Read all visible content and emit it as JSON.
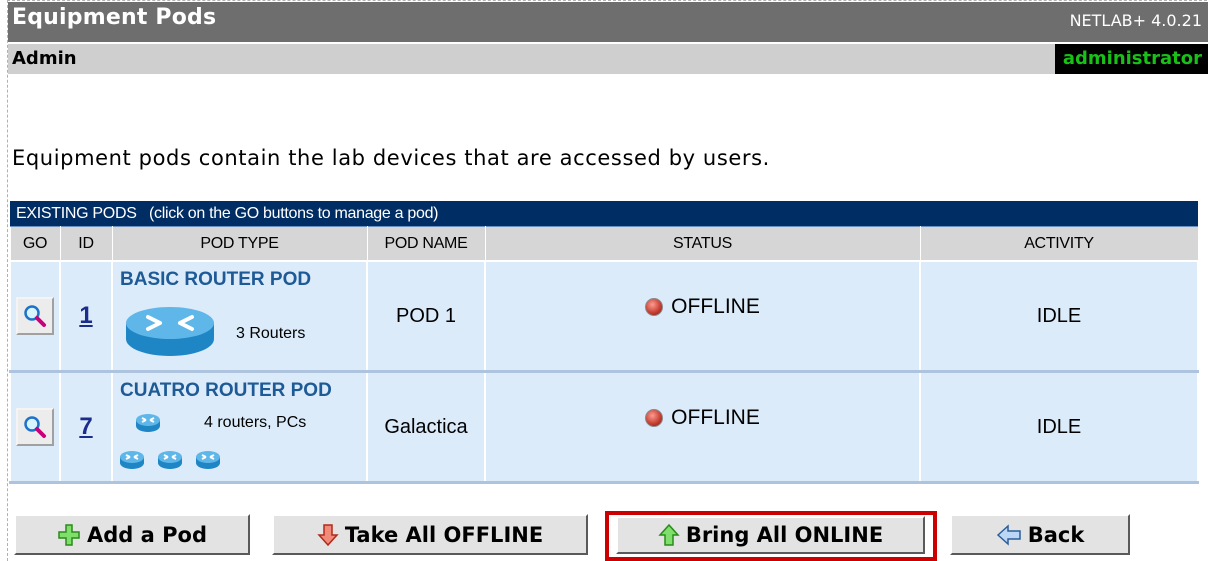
{
  "header": {
    "title": "Equipment Pods",
    "version": "NETLAB+ 4.0.21",
    "section": "Admin",
    "user": "administrator"
  },
  "intro": "Equipment pods contain the lab devices that are accessed by users.",
  "table": {
    "caption": "EXISTING PODS   (click on the GO buttons to manage a pod)",
    "columns": [
      "GO",
      "ID",
      "POD TYPE",
      "POD NAME",
      "STATUS",
      "ACTIVITY"
    ],
    "rows": [
      {
        "id": "1",
        "pod_type": "BASIC ROUTER POD",
        "pod_desc": "3 Routers",
        "pod_name": "POD 1",
        "status": "OFFLINE",
        "activity": "IDLE"
      },
      {
        "id": "7",
        "pod_type": "CUATRO ROUTER POD",
        "pod_desc": "4 routers, PCs",
        "pod_name": "Galactica",
        "status": "OFFLINE",
        "activity": "IDLE"
      }
    ]
  },
  "buttons": {
    "add": "Add a Pod",
    "offline": "Take All OFFLINE",
    "online": "Bring All ONLINE",
    "back": "Back"
  },
  "colors": {
    "title_bar": "#6e6e6e",
    "table_header": "#002d63",
    "row_bg": "#dcebfa",
    "user_text": "#18c018",
    "highlight": "#cc0000"
  },
  "icons": {
    "go": "magnifier-icon",
    "router": "router-icon",
    "status": "offline-status-icon",
    "add": "plus-icon",
    "offline": "down-arrow-icon",
    "online": "up-arrow-icon",
    "back": "left-arrow-icon"
  }
}
